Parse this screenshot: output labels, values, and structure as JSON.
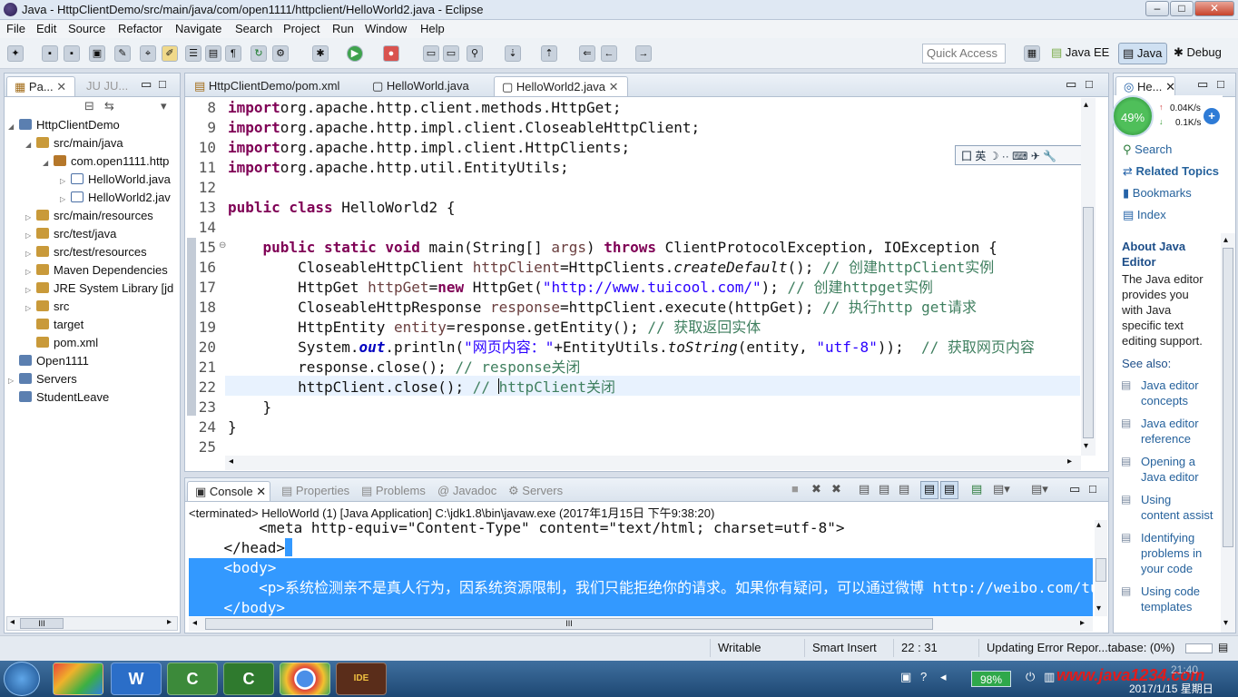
{
  "window": {
    "title": "Java - HttpClientDemo/src/main/java/com/open1111/httpclient/HelloWorld2.java - Eclipse",
    "min": "–",
    "max": "□",
    "close": "✕"
  },
  "menu": [
    "File",
    "Edit",
    "Source",
    "Refactor",
    "Navigate",
    "Search",
    "Project",
    "Run",
    "Window",
    "Help"
  ],
  "toolbar": {
    "quick_access_placeholder": "Quick Access",
    "perspectives": [
      "Java EE",
      "Java",
      "Debug"
    ]
  },
  "package_explorer": {
    "tabs": [
      "Pa...",
      "JU JU..."
    ],
    "items": [
      {
        "label": "HttpClientDemo",
        "indent": 0
      },
      {
        "label": "src/main/java",
        "indent": 1
      },
      {
        "label": "com.open1111.http",
        "indent": 2
      },
      {
        "label": "HelloWorld.java",
        "indent": 3
      },
      {
        "label": "HelloWorld2.jav",
        "indent": 3
      },
      {
        "label": "src/main/resources",
        "indent": 1
      },
      {
        "label": "src/test/java",
        "indent": 1
      },
      {
        "label": "src/test/resources",
        "indent": 1
      },
      {
        "label": "Maven Dependencies",
        "indent": 1
      },
      {
        "label": "JRE System Library [jd",
        "indent": 1
      },
      {
        "label": "src",
        "indent": 1
      },
      {
        "label": "target",
        "indent": 1
      },
      {
        "label": "pom.xml",
        "indent": 1
      },
      {
        "label": "Open1111",
        "indent": 0
      },
      {
        "label": "Servers",
        "indent": 0
      },
      {
        "label": "StudentLeave",
        "indent": 0
      }
    ],
    "hscroll": "III"
  },
  "editor": {
    "tabs": [
      "HttpClientDemo/pom.xml",
      "HelloWorld.java",
      "HelloWorld2.java"
    ],
    "active_tab": "HelloWorld2.java",
    "ime_toolbar": "囗 英 ☽ ·· ⌨ ✈ 🔧",
    "lines": [
      {
        "n": "8",
        "parts": [
          [
            "kw",
            "import"
          ],
          [
            "",
            "org.apache.http.client.methods.HttpGet;"
          ]
        ]
      },
      {
        "n": "9",
        "parts": [
          [
            "kw",
            "import"
          ],
          [
            "",
            "org.apache.http.impl.client.CloseableHttpClient;"
          ]
        ]
      },
      {
        "n": "10",
        "parts": [
          [
            "kw",
            "import"
          ],
          [
            "",
            "org.apache.http.impl.client.HttpClients;"
          ]
        ]
      },
      {
        "n": "11",
        "parts": [
          [
            "kw",
            "import"
          ],
          [
            "",
            "org.apache.http.util.EntityUtils;"
          ]
        ]
      },
      {
        "n": "12",
        "parts": []
      },
      {
        "n": "13",
        "parts": [
          [
            "kw",
            "public class"
          ],
          [
            "",
            " HelloWorld2 {"
          ]
        ]
      },
      {
        "n": "14",
        "parts": []
      },
      {
        "n": "15",
        "parts": [
          [
            "",
            "    "
          ],
          [
            "kw",
            "public static void"
          ],
          [
            "",
            " main(String[] "
          ],
          [
            "var",
            "args"
          ],
          [
            "",
            ") "
          ],
          [
            "kw",
            "throws"
          ],
          [
            "",
            " ClientProtocolException, IOException {"
          ]
        ]
      },
      {
        "n": "16",
        "parts": [
          [
            "",
            "        CloseableHttpClient "
          ],
          [
            "var",
            "httpClient"
          ],
          [
            "",
            "=HttpClients."
          ],
          [
            "it",
            "createDefault"
          ],
          [
            "",
            "(); "
          ],
          [
            "cm",
            "// 创建httpClient实例"
          ]
        ]
      },
      {
        "n": "17",
        "parts": [
          [
            "",
            "        HttpGet "
          ],
          [
            "var",
            "httpGet"
          ],
          [
            "",
            "="
          ],
          [
            "kw",
            "new"
          ],
          [
            "",
            " HttpGet("
          ],
          [
            "str",
            "\"http://www.tuicool.com/\""
          ],
          [
            "",
            "); "
          ],
          [
            "cm",
            "// 创建httpget实例"
          ]
        ]
      },
      {
        "n": "18",
        "parts": [
          [
            "",
            "        CloseableHttpResponse "
          ],
          [
            "var",
            "response"
          ],
          [
            "",
            "=httpClient.execute(httpGet); "
          ],
          [
            "cm",
            "// 执行http get请求"
          ]
        ]
      },
      {
        "n": "19",
        "parts": [
          [
            "",
            "        HttpEntity "
          ],
          [
            "var",
            "entity"
          ],
          [
            "",
            "=response.getEntity(); "
          ],
          [
            "cm",
            "// 获取返回实体"
          ]
        ]
      },
      {
        "n": "20",
        "parts": [
          [
            "",
            "        System."
          ],
          [
            "out",
            "out"
          ],
          [
            "",
            ".println("
          ],
          [
            "str",
            "\"网页内容：\""
          ],
          [
            "",
            "+EntityUtils."
          ],
          [
            "it",
            "toString"
          ],
          [
            "",
            "(entity, "
          ],
          [
            "str",
            "\"utf-8\""
          ],
          [
            "",
            "));  "
          ],
          [
            "cm",
            "// 获取网页内容"
          ]
        ]
      },
      {
        "n": "21",
        "parts": [
          [
            "",
            "        response.close(); "
          ],
          [
            "cm",
            "// response关闭"
          ]
        ]
      },
      {
        "n": "22",
        "parts": [
          [
            "",
            "        httpClient.close(); "
          ],
          [
            "cm",
            "// httpClient关闭"
          ]
        ]
      },
      {
        "n": "23",
        "parts": [
          [
            "",
            "    }"
          ]
        ]
      },
      {
        "n": "24",
        "parts": [
          [
            "",
            "}"
          ]
        ]
      },
      {
        "n": "25",
        "parts": []
      }
    ]
  },
  "help_panel": {
    "tab": "He...",
    "cpu_percent": "49%",
    "net_up": "0.04K/s",
    "net_down": "0.1K/s",
    "links": [
      "Search",
      "Related Topics",
      "Bookmarks",
      "Index"
    ],
    "about_title": "About Java Editor",
    "about_text": [
      "The Java editor",
      "provides you",
      "with Java",
      "specific text",
      "editing support."
    ],
    "see_also": "See also:",
    "topics": [
      [
        "Java editor",
        "concepts"
      ],
      [
        "Java editor",
        "reference"
      ],
      [
        "Opening a",
        "Java editor"
      ],
      [
        "Using",
        "content assist"
      ],
      [
        "Identifying",
        "problems in",
        "your code"
      ],
      [
        "Using code",
        "templates"
      ]
    ]
  },
  "console": {
    "tabs": [
      "Console",
      "Properties",
      "Problems",
      "Javadoc",
      "Servers"
    ],
    "status": "<terminated> HelloWorld (1) [Java Application] C:\\jdk1.8\\bin\\javaw.exe (2017年1月15日 下午9:38:20)",
    "lines": [
      {
        "text": "        <meta http-equiv=\"Content-Type\" content=\"text/html; charset=utf-8\">",
        "sel": "none"
      },
      {
        "text": "    </head>",
        "sel": "tail"
      },
      {
        "text": "    <body>",
        "sel": "full"
      },
      {
        "text": "        <p>系统检测亲不是真人行为，因系统资源限制，我们只能拒绝你的请求。如果你有疑问，可以通过微博 http://weibo.com/tuico",
        "sel": "full"
      },
      {
        "text": "    </body>",
        "sel": "full"
      }
    ],
    "hscroll": "III"
  },
  "statusbar": {
    "writable": "Writable",
    "insert_mode": "Smart Insert",
    "position": "22 : 31",
    "progress": "Updating Error Repor...tabase: (0%)"
  },
  "taskbar": {
    "battery": "98%",
    "clock_time": "21:40",
    "clock_date": "2017/1/15 星期日",
    "watermark": "www.java1234.com"
  },
  "colors": {
    "keyword": "#7f0055",
    "comment": "#3f7f5f",
    "string": "#2a00ff",
    "selection": "#3399ff"
  }
}
